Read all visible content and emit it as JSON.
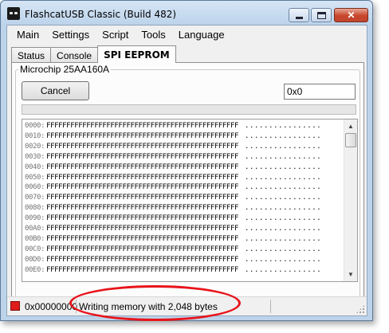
{
  "window": {
    "title": "FlashcatUSB Classic (Build 482)"
  },
  "window_controls": {
    "close_symbol": "✕"
  },
  "menu": [
    "Main",
    "Settings",
    "Script",
    "Tools",
    "Language"
  ],
  "tabs": [
    {
      "label": "Status",
      "active": false
    },
    {
      "label": "Console",
      "active": false
    },
    {
      "label": "SPI EEPROM",
      "active": true
    }
  ],
  "eeprom_panel": {
    "group_title": "Microchip 25AA160A",
    "cancel_label": "Cancel",
    "address_value": "0x0",
    "progress_fraction": 0.0
  },
  "hex_view": {
    "rows": [
      {
        "address": "0000:",
        "bytes": "FFFFFFFFFFFFFFFFFFFFFFFFFFFFFFFFFFFFFFFFFFFFFFFF",
        "ascii": "................"
      },
      {
        "address": "0010:",
        "bytes": "FFFFFFFFFFFFFFFFFFFFFFFFFFFFFFFFFFFFFFFFFFFFFFFF",
        "ascii": "................"
      },
      {
        "address": "0020:",
        "bytes": "FFFFFFFFFFFFFFFFFFFFFFFFFFFFFFFFFFFFFFFFFFFFFFFF",
        "ascii": "................"
      },
      {
        "address": "0030:",
        "bytes": "FFFFFFFFFFFFFFFFFFFFFFFFFFFFFFFFFFFFFFFFFFFFFFFF",
        "ascii": "................"
      },
      {
        "address": "0040:",
        "bytes": "FFFFFFFFFFFFFFFFFFFFFFFFFFFFFFFFFFFFFFFFFFFFFFFF",
        "ascii": "................"
      },
      {
        "address": "0050:",
        "bytes": "FFFFFFFFFFFFFFFFFFFFFFFFFFFFFFFFFFFFFFFFFFFFFFFF",
        "ascii": "................"
      },
      {
        "address": "0060:",
        "bytes": "FFFFFFFFFFFFFFFFFFFFFFFFFFFFFFFFFFFFFFFFFFFFFFFF",
        "ascii": "................"
      },
      {
        "address": "0070:",
        "bytes": "FFFFFFFFFFFFFFFFFFFFFFFFFFFFFFFFFFFFFFFFFFFFFFFF",
        "ascii": "................"
      },
      {
        "address": "0080:",
        "bytes": "FFFFFFFFFFFFFFFFFFFFFFFFFFFFFFFFFFFFFFFFFFFFFFFF",
        "ascii": "................"
      },
      {
        "address": "0090:",
        "bytes": "FFFFFFFFFFFFFFFFFFFFFFFFFFFFFFFFFFFFFFFFFFFFFFFF",
        "ascii": "................"
      },
      {
        "address": "00A0:",
        "bytes": "FFFFFFFFFFFFFFFFFFFFFFFFFFFFFFFFFFFFFFFFFFFFFFFF",
        "ascii": "................"
      },
      {
        "address": "00B0:",
        "bytes": "FFFFFFFFFFFFFFFFFFFFFFFFFFFFFFFFFFFFFFFFFFFFFFFF",
        "ascii": "................"
      },
      {
        "address": "00C0:",
        "bytes": "FFFFFFFFFFFFFFFFFFFFFFFFFFFFFFFFFFFFFFFFFFFFFFFF",
        "ascii": "................"
      },
      {
        "address": "00D0:",
        "bytes": "FFFFFFFFFFFFFFFFFFFFFFFFFFFFFFFFFFFFFFFFFFFFFFFF",
        "ascii": "................"
      },
      {
        "address": "00E0:",
        "bytes": "FFFFFFFFFFFFFFFFFFFFFFFFFFFFFFFFFFFFFFFFFFFFFFFF",
        "ascii": "................"
      }
    ]
  },
  "statusbar": {
    "led_color": "#e01b1b",
    "address": "0x00000000",
    "message": "Writing memory with 2,048 bytes"
  },
  "annotation": {
    "color": "#e8141b"
  }
}
